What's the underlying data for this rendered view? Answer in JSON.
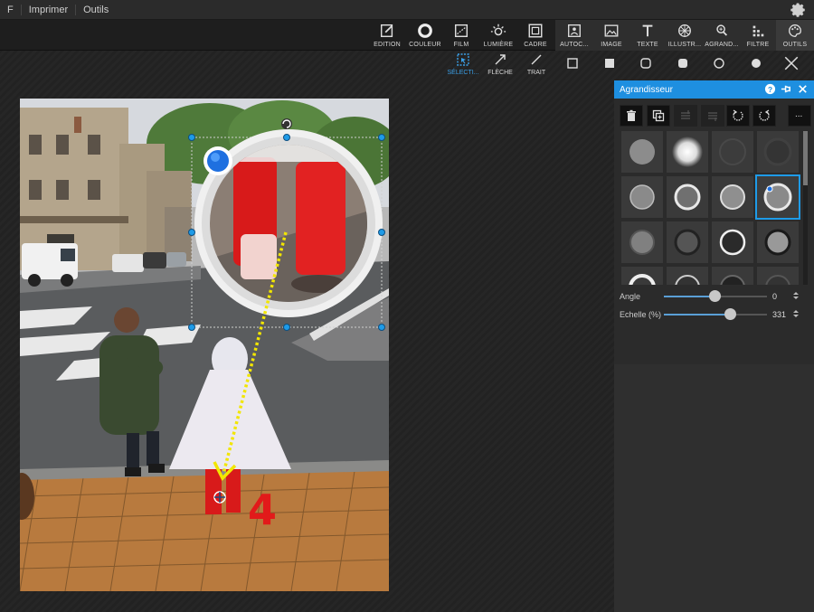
{
  "menubar": {
    "items": [
      "F",
      "Imprimer",
      "Outils"
    ]
  },
  "toolbar": {
    "items": [
      {
        "label": "EDITION",
        "icon": "edit-icon"
      },
      {
        "label": "COULEUR",
        "icon": "color-ring-icon"
      },
      {
        "label": "FILM",
        "icon": "film-icon"
      },
      {
        "label": "LUMIÈRE",
        "icon": "sun-icon"
      },
      {
        "label": "CADRE",
        "icon": "frame-icon"
      },
      {
        "label": "AUTOC...",
        "icon": "autocollant-icon"
      },
      {
        "label": "IMAGE",
        "icon": "image-icon"
      },
      {
        "label": "TEXTE",
        "icon": "text-icon"
      },
      {
        "label": "ILLUSTR...",
        "icon": "illustration-icon"
      },
      {
        "label": "AGRAND...",
        "icon": "magnifier-icon"
      },
      {
        "label": "FILTRE",
        "icon": "filter-icon"
      },
      {
        "label": "OUTILS",
        "icon": "palette-icon"
      }
    ]
  },
  "subtoolbar": {
    "items": [
      {
        "label": "SÉLECTI...",
        "icon": "selection-icon",
        "active": true
      },
      {
        "label": "FLÈCHE",
        "icon": "arrow-icon",
        "active": false
      },
      {
        "label": "TRAIT",
        "icon": "line-icon",
        "active": false
      }
    ]
  },
  "canvas": {
    "annotation_number": "4",
    "accent_arrow_color": "#f2e600",
    "number_color": "#e21a1a"
  },
  "panel": {
    "title": "Agrandisseur",
    "tools": [
      "trash-icon",
      "duplicate-icon",
      "bring-front-icon",
      "send-back-icon",
      "rotate-left-icon",
      "rotate-right-icon",
      "more-icon"
    ],
    "more_label": "...",
    "params": {
      "angle_label": "Angle",
      "angle_value": "0",
      "angle_fraction": 0.49,
      "scale_label": "Echelle (%)",
      "scale_value": "331",
      "scale_fraction": 0.64
    },
    "accent_color": "#1e8fe0"
  }
}
